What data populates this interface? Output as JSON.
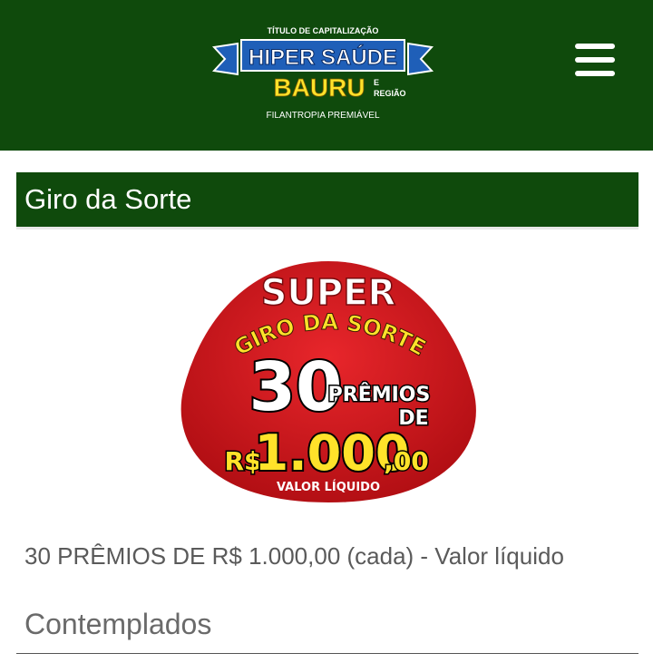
{
  "header": {
    "logo": {
      "top_line": "TÍTULO DE CAPITALIZAÇÃO",
      "brand_line1": "HIPER SAÚDE",
      "brand_line2": "BAURU",
      "brand_suffix_top": "E",
      "brand_suffix_bottom": "REGIÃO",
      "bottom_line": "FILANTROPIA PREMIÁVEL"
    },
    "menu_icon": "hamburger-menu-icon"
  },
  "section": {
    "title": "Giro da Sorte"
  },
  "promo_badge": {
    "super": "SUPER",
    "giro": "GIRO DA SORTE",
    "count": "30",
    "premios": "PRÊMIOS",
    "de": "DE",
    "currency": "R$",
    "amount": "1.000",
    "cents": ",00",
    "note": "VALOR LÍQUIDO"
  },
  "description": "30 PRÊMIOS DE R$ 1.000,00 (cada) - Valor líquido",
  "winners": {
    "title": "Contemplados"
  },
  "colors": {
    "header_green": "#0f4a0c",
    "badge_red": "#d7191f",
    "logo_blue": "#1f5fb8",
    "logo_yellow": "#ffe22a"
  }
}
